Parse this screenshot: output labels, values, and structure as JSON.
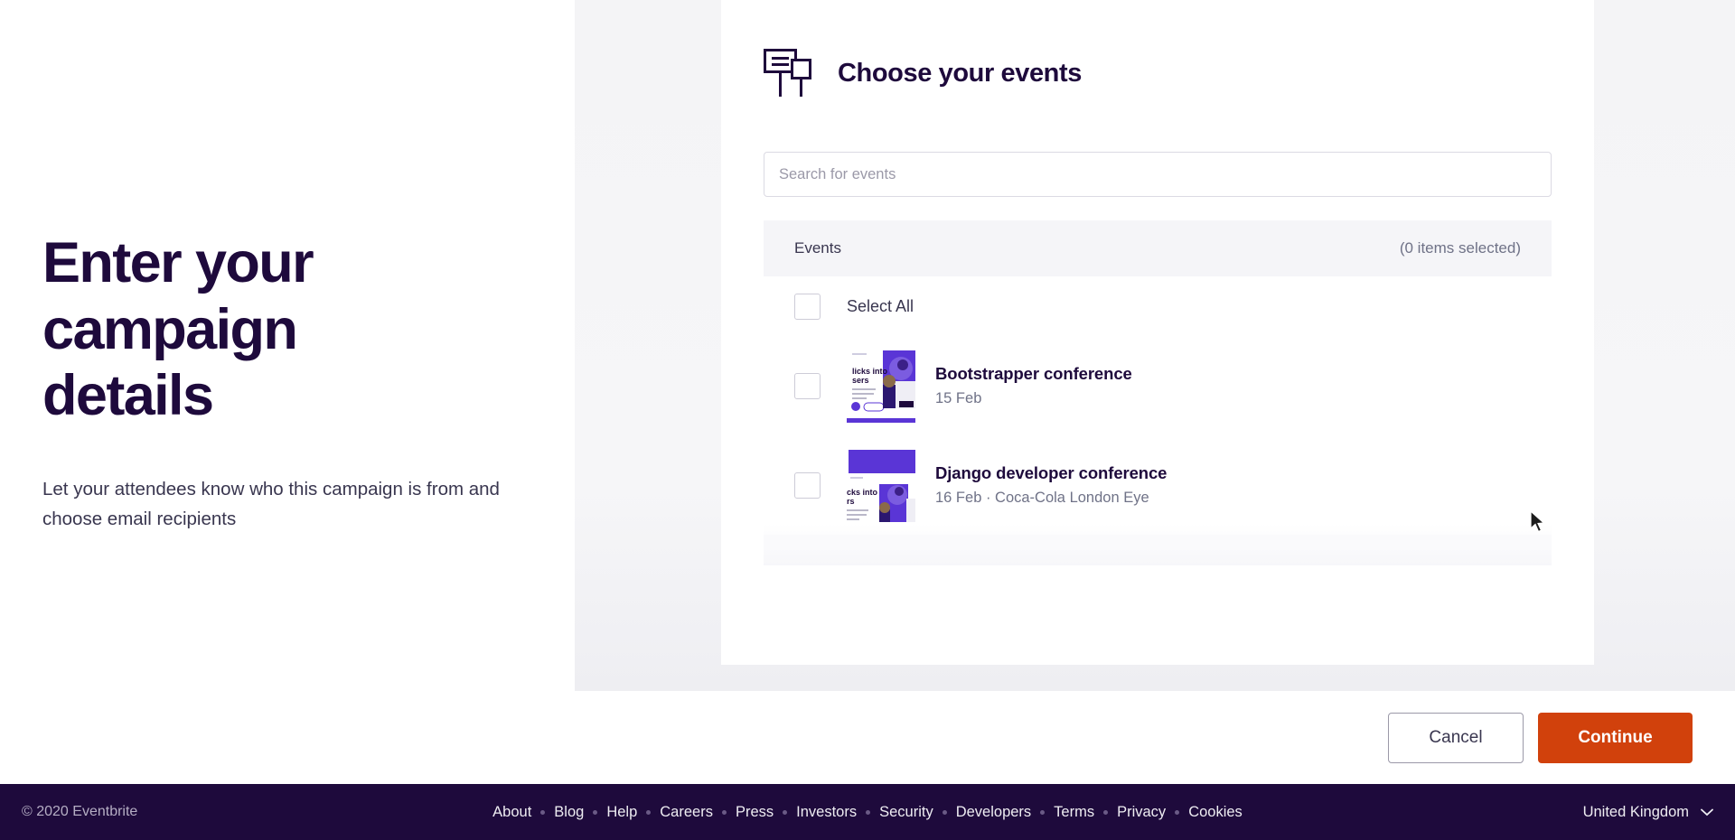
{
  "intro": {
    "title": "Enter your campaign details",
    "subtitle": "Let your attendees know who this campaign is from and choose email recipients"
  },
  "modal": {
    "icon": "signs-icon",
    "title": "Choose your events",
    "search": {
      "placeholder": "Search for events",
      "value": ""
    },
    "list": {
      "header_label": "Events",
      "selected_count_label": "(0 items selected)",
      "select_all_label": "Select All",
      "items": [
        {
          "name": "Bootstrapper conference",
          "meta": "15 Feb",
          "checked": false
        },
        {
          "name": "Django developer conference",
          "meta": "16 Feb · Coca-Cola London Eye",
          "checked": false
        }
      ]
    }
  },
  "actions": {
    "cancel_label": "Cancel",
    "continue_label": "Continue"
  },
  "footer": {
    "copyright": "© 2020 Eventbrite",
    "links": [
      "About",
      "Blog",
      "Help",
      "Careers",
      "Press",
      "Investors",
      "Security",
      "Developers",
      "Terms",
      "Privacy",
      "Cookies"
    ],
    "locale": "United Kingdom"
  },
  "colors": {
    "brand_purple": "#1e0a3c",
    "accent_orange": "#d1410c",
    "thumb_purple": "#5a35d6",
    "panel_gray": "#f5f5f7"
  }
}
